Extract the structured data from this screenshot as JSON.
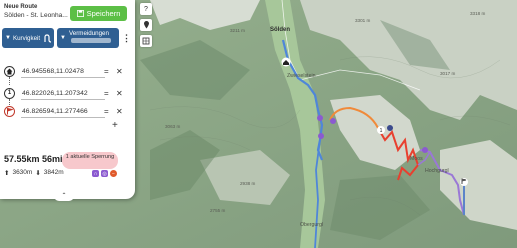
{
  "header": {
    "title": "Neue Route",
    "subtitle": "Sölden - St. Leonha...",
    "save_label": "Speichern"
  },
  "toolbar": {
    "curvy_label": "Kurvigkeit",
    "avoid_label": "Vermeidungen",
    "more_label": "⋮"
  },
  "waypoints": [
    {
      "marker": "home",
      "coords": "46.945568,11.02478"
    },
    {
      "marker": "1",
      "coords": "46.822026,11.207342"
    },
    {
      "marker": "flag",
      "coords": "46.826594,11.277466"
    }
  ],
  "summary": {
    "distance": "57.55km",
    "duration": "56min",
    "ascent": "3630m",
    "descent": "3842m",
    "closure": "1 aktuelle Sperrung"
  },
  "map": {
    "towns": [
      "Sölden",
      "Zwieselstein",
      "Obergurgl",
      "Moos",
      "Hochgurgl"
    ],
    "peaks": [
      "3301 m",
      "3211 m",
      "3063 m",
      "2938 m",
      "3017 m",
      "3318 m",
      "2755 m"
    ],
    "route_colors": {
      "blue": "#4f86d9",
      "red": "#e8402f",
      "orange": "#f08a3a",
      "purple": "#9a78d6"
    }
  },
  "controls": [
    "?",
    "pin-icon",
    "satellite-icon"
  ]
}
